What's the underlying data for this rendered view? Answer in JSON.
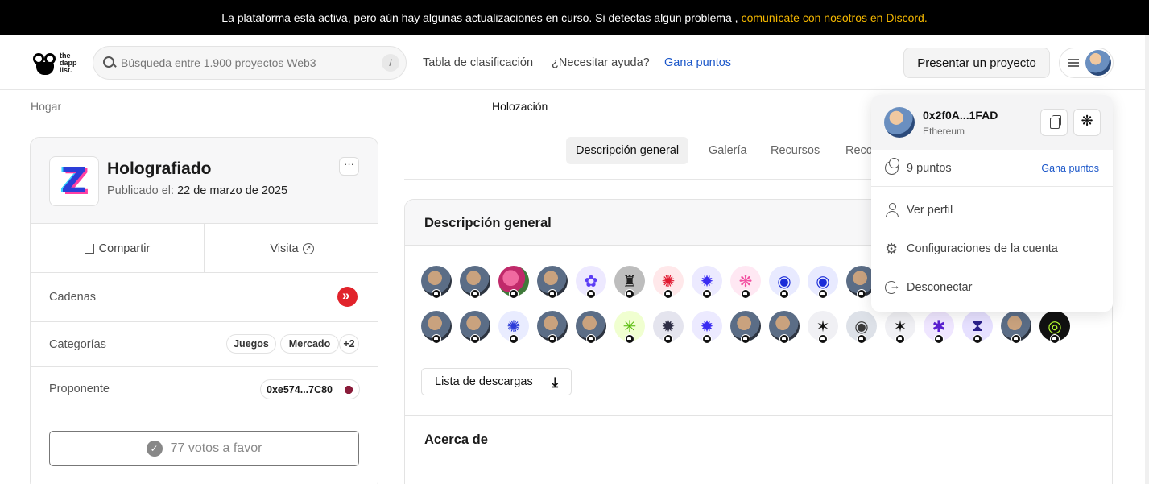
{
  "banner": {
    "text": "La plataforma está activa, pero aún hay algunas actualizaciones en curso. Si detectas algún problema ,",
    "link": "comunícate con nosotros en Discord",
    "link_end": "."
  },
  "header": {
    "logo_lines": [
      "the",
      "dapp",
      "list."
    ],
    "search_placeholder": "Búsqueda entre 1.900 proyectos Web3",
    "search_shortcut": "/",
    "nav": [
      "Tabla de clasificación",
      "¿Necesitar ayuda?",
      "Gana puntos"
    ],
    "submit_label": "Presentar un proyecto"
  },
  "breadcrumb": {
    "home": "Hogar",
    "current": "Holozación"
  },
  "project": {
    "name": "Holografiado",
    "published_label": "Publicado el:",
    "published_date": "22 de marzo de 2025",
    "more_label": "···",
    "share_label": "Compartir",
    "visit_label": "Visita",
    "chains_label": "Cadenas",
    "categories_label": "Categorías",
    "categories": [
      "Juegos",
      "Mercado",
      "+2"
    ],
    "proposer_label": "Proponente",
    "proposer_address": "0xe574...7C80",
    "votes_label": "77 votos a favor"
  },
  "tabs": [
    "Descripción general",
    "Galería",
    "Recursos",
    "Reco"
  ],
  "overview": {
    "title": "Descripción general",
    "download_label": "Lista de descargas",
    "about_title": "Acerca de",
    "avatars_row1": [
      "photo-1",
      "photo-2",
      "roses",
      "photo-3",
      "purple-flower",
      "hat",
      "red-burst",
      "blue-burst",
      "pink-burst",
      "blue-ring",
      "blue-ring",
      "photo-4"
    ],
    "avatars_row2": [
      "photo-5",
      "photo-6",
      "blue-dots",
      "photo-7",
      "photo-8",
      "green-star",
      "dark-star",
      "blue-burst",
      "photo-9",
      "photo-10",
      "black-star",
      "black-ring",
      "black-star",
      "purple-star",
      "purple-hourglass",
      "photo-11",
      "green-swirl"
    ]
  },
  "dropdown": {
    "address": "0x2f0A...1FAD",
    "chain": "Ethereum",
    "points": "9 puntos",
    "earn_points": "Gana puntos",
    "items": [
      "Ver perfil",
      "Configuraciones de la cuenta",
      "Desconectar"
    ]
  },
  "colors": {
    "accent_link": "#1a56c9",
    "banner_link": "#f5b800",
    "chain_red": "#e1232b"
  }
}
